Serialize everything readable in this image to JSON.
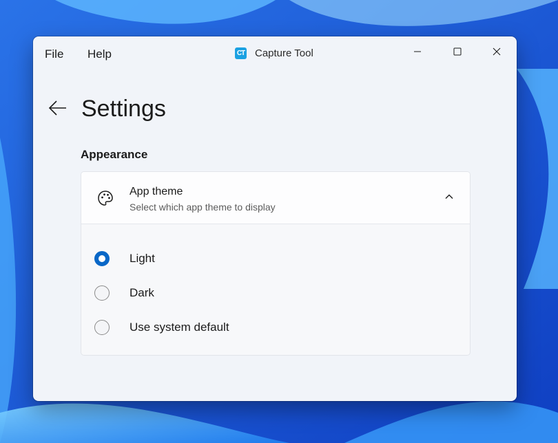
{
  "menu": {
    "file": "File",
    "help": "Help"
  },
  "app": {
    "icon_text": "CT",
    "title": "Capture Tool",
    "icon_color": "#1ba1e2"
  },
  "window_controls": {
    "minimize": "minimize-icon",
    "maximize": "maximize-icon",
    "close": "close-icon"
  },
  "page": {
    "back": "back-arrow-icon",
    "title": "Settings"
  },
  "section": {
    "title": "Appearance"
  },
  "theme_expander": {
    "icon": "palette-icon",
    "title": "App theme",
    "subtitle": "Select which app theme to display",
    "expanded": true,
    "options": [
      {
        "label": "Light",
        "checked": true
      },
      {
        "label": "Dark",
        "checked": false
      },
      {
        "label": "Use system default",
        "checked": false
      }
    ]
  },
  "colors": {
    "accent": "#0867c7",
    "window_bg": "#f1f4f9"
  }
}
